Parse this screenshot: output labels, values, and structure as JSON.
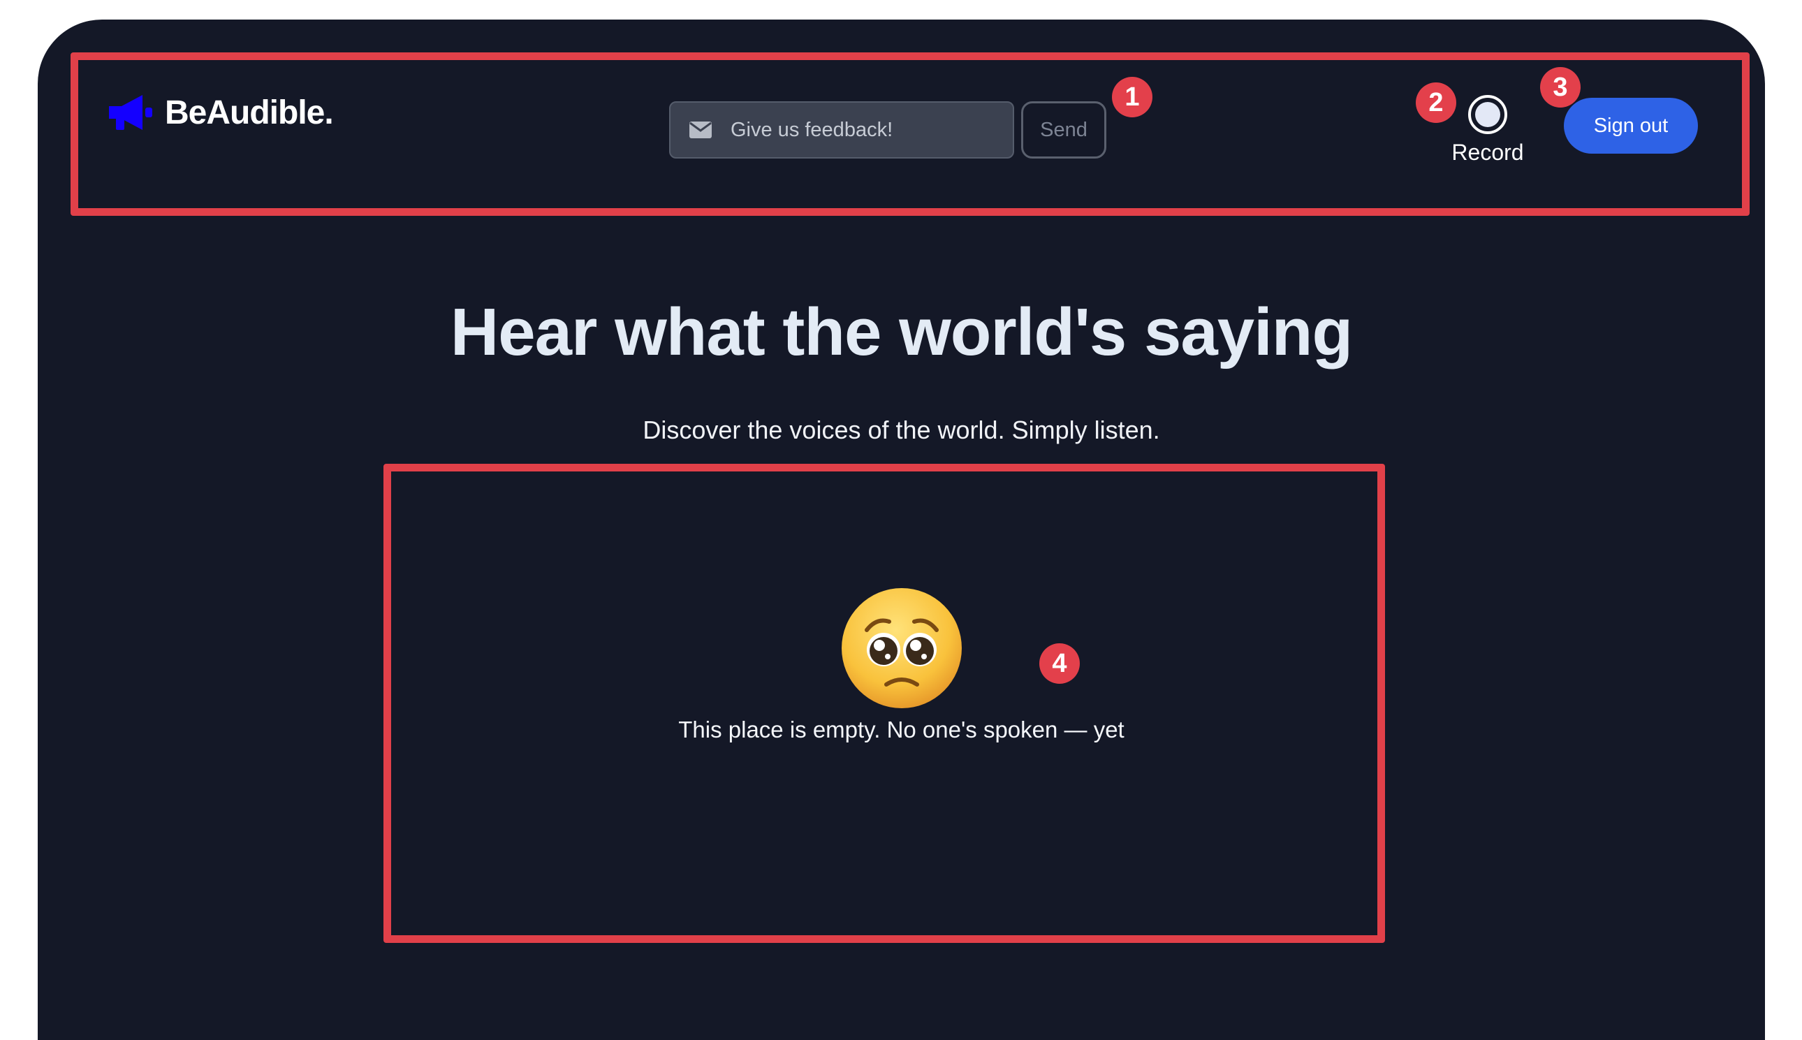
{
  "header": {
    "brand_name": "BeAudible.",
    "brand_icon": "megaphone-icon",
    "feedback": {
      "placeholder": "Give us feedback!",
      "icon": "mail-icon",
      "send_label": "Send"
    },
    "record": {
      "label": "Record",
      "icon": "record-icon"
    },
    "signout_label": "Sign out"
  },
  "hero": {
    "title": "Hear what the world's saying",
    "subtitle": "Discover the voices of the world. Simply listen."
  },
  "empty_state": {
    "icon": "pleading-face-icon",
    "message": "This place is empty. No one's spoken — yet"
  },
  "annotations": [
    "1",
    "2",
    "3",
    "4"
  ],
  "colors": {
    "background": "#141827",
    "brand_icon": "#1400ff",
    "primary_button": "#2e62e6",
    "annotation": "#e14049"
  }
}
